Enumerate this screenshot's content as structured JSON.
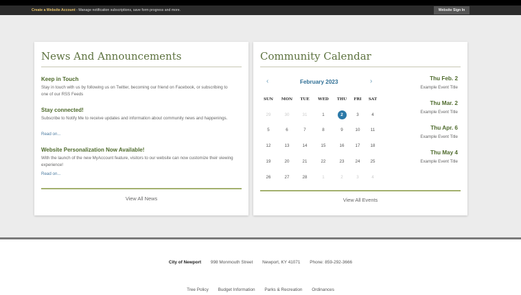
{
  "topbar": {
    "account_link": "Create a Website Account",
    "message": " - Manage notification subscriptions, save form progress and more.",
    "signin": "Website Sign In"
  },
  "news": {
    "title": "News And Announcements",
    "items": [
      {
        "title": "Keep in Touch",
        "text": "Stay in touch with us by following us on Twitter, becoming our friend on Facebook, or subscribing to one of our RSS Feeds"
      },
      {
        "title": "Stay connected!",
        "text": "Subscribe to Notify Me to receive updates and information about community news and happenings.",
        "more": "Read on..."
      },
      {
        "title": "Website Personalization Now Available!",
        "text": "With the launch of the new MyAccount feature, visitors to our website can now customize their viewing experience!",
        "more": "Read on..."
      }
    ],
    "view_all": "View All News"
  },
  "calendar": {
    "title": "Community Calendar",
    "month": "February 2023",
    "prev": "‹",
    "next": "›",
    "weekdays": [
      "SUN",
      "MON",
      "TUE",
      "WED",
      "THU",
      "FRI",
      "SAT"
    ],
    "weeks": [
      [
        "29",
        "30",
        "31",
        "1",
        "2",
        "3",
        "4"
      ],
      [
        "5",
        "6",
        "7",
        "8",
        "9",
        "10",
        "11"
      ],
      [
        "12",
        "13",
        "14",
        "15",
        "16",
        "17",
        "18"
      ],
      [
        "19",
        "20",
        "21",
        "22",
        "23",
        "24",
        "25"
      ],
      [
        "26",
        "27",
        "28",
        "1",
        "2",
        "3",
        "4"
      ]
    ],
    "today": "2",
    "events": [
      {
        "date": "Thu Feb. 2",
        "title": "Example Event Title"
      },
      {
        "date": "Thu Mar. 2",
        "title": "Example Event Title"
      },
      {
        "date": "Thu Apr. 6",
        "title": "Example Event Title"
      },
      {
        "date": "Thu May 4",
        "title": "Example Event Title"
      }
    ],
    "view_all": "View All Events"
  },
  "footer": {
    "city": "City of Newport",
    "address": "998 Monmouth Street",
    "citystate": "Newport, KY 41071",
    "phone": "Phone: 859-292-3666",
    "links": [
      "Tree Policy",
      "Budget Information",
      "Parks & Recreation",
      "Ordinances"
    ]
  }
}
